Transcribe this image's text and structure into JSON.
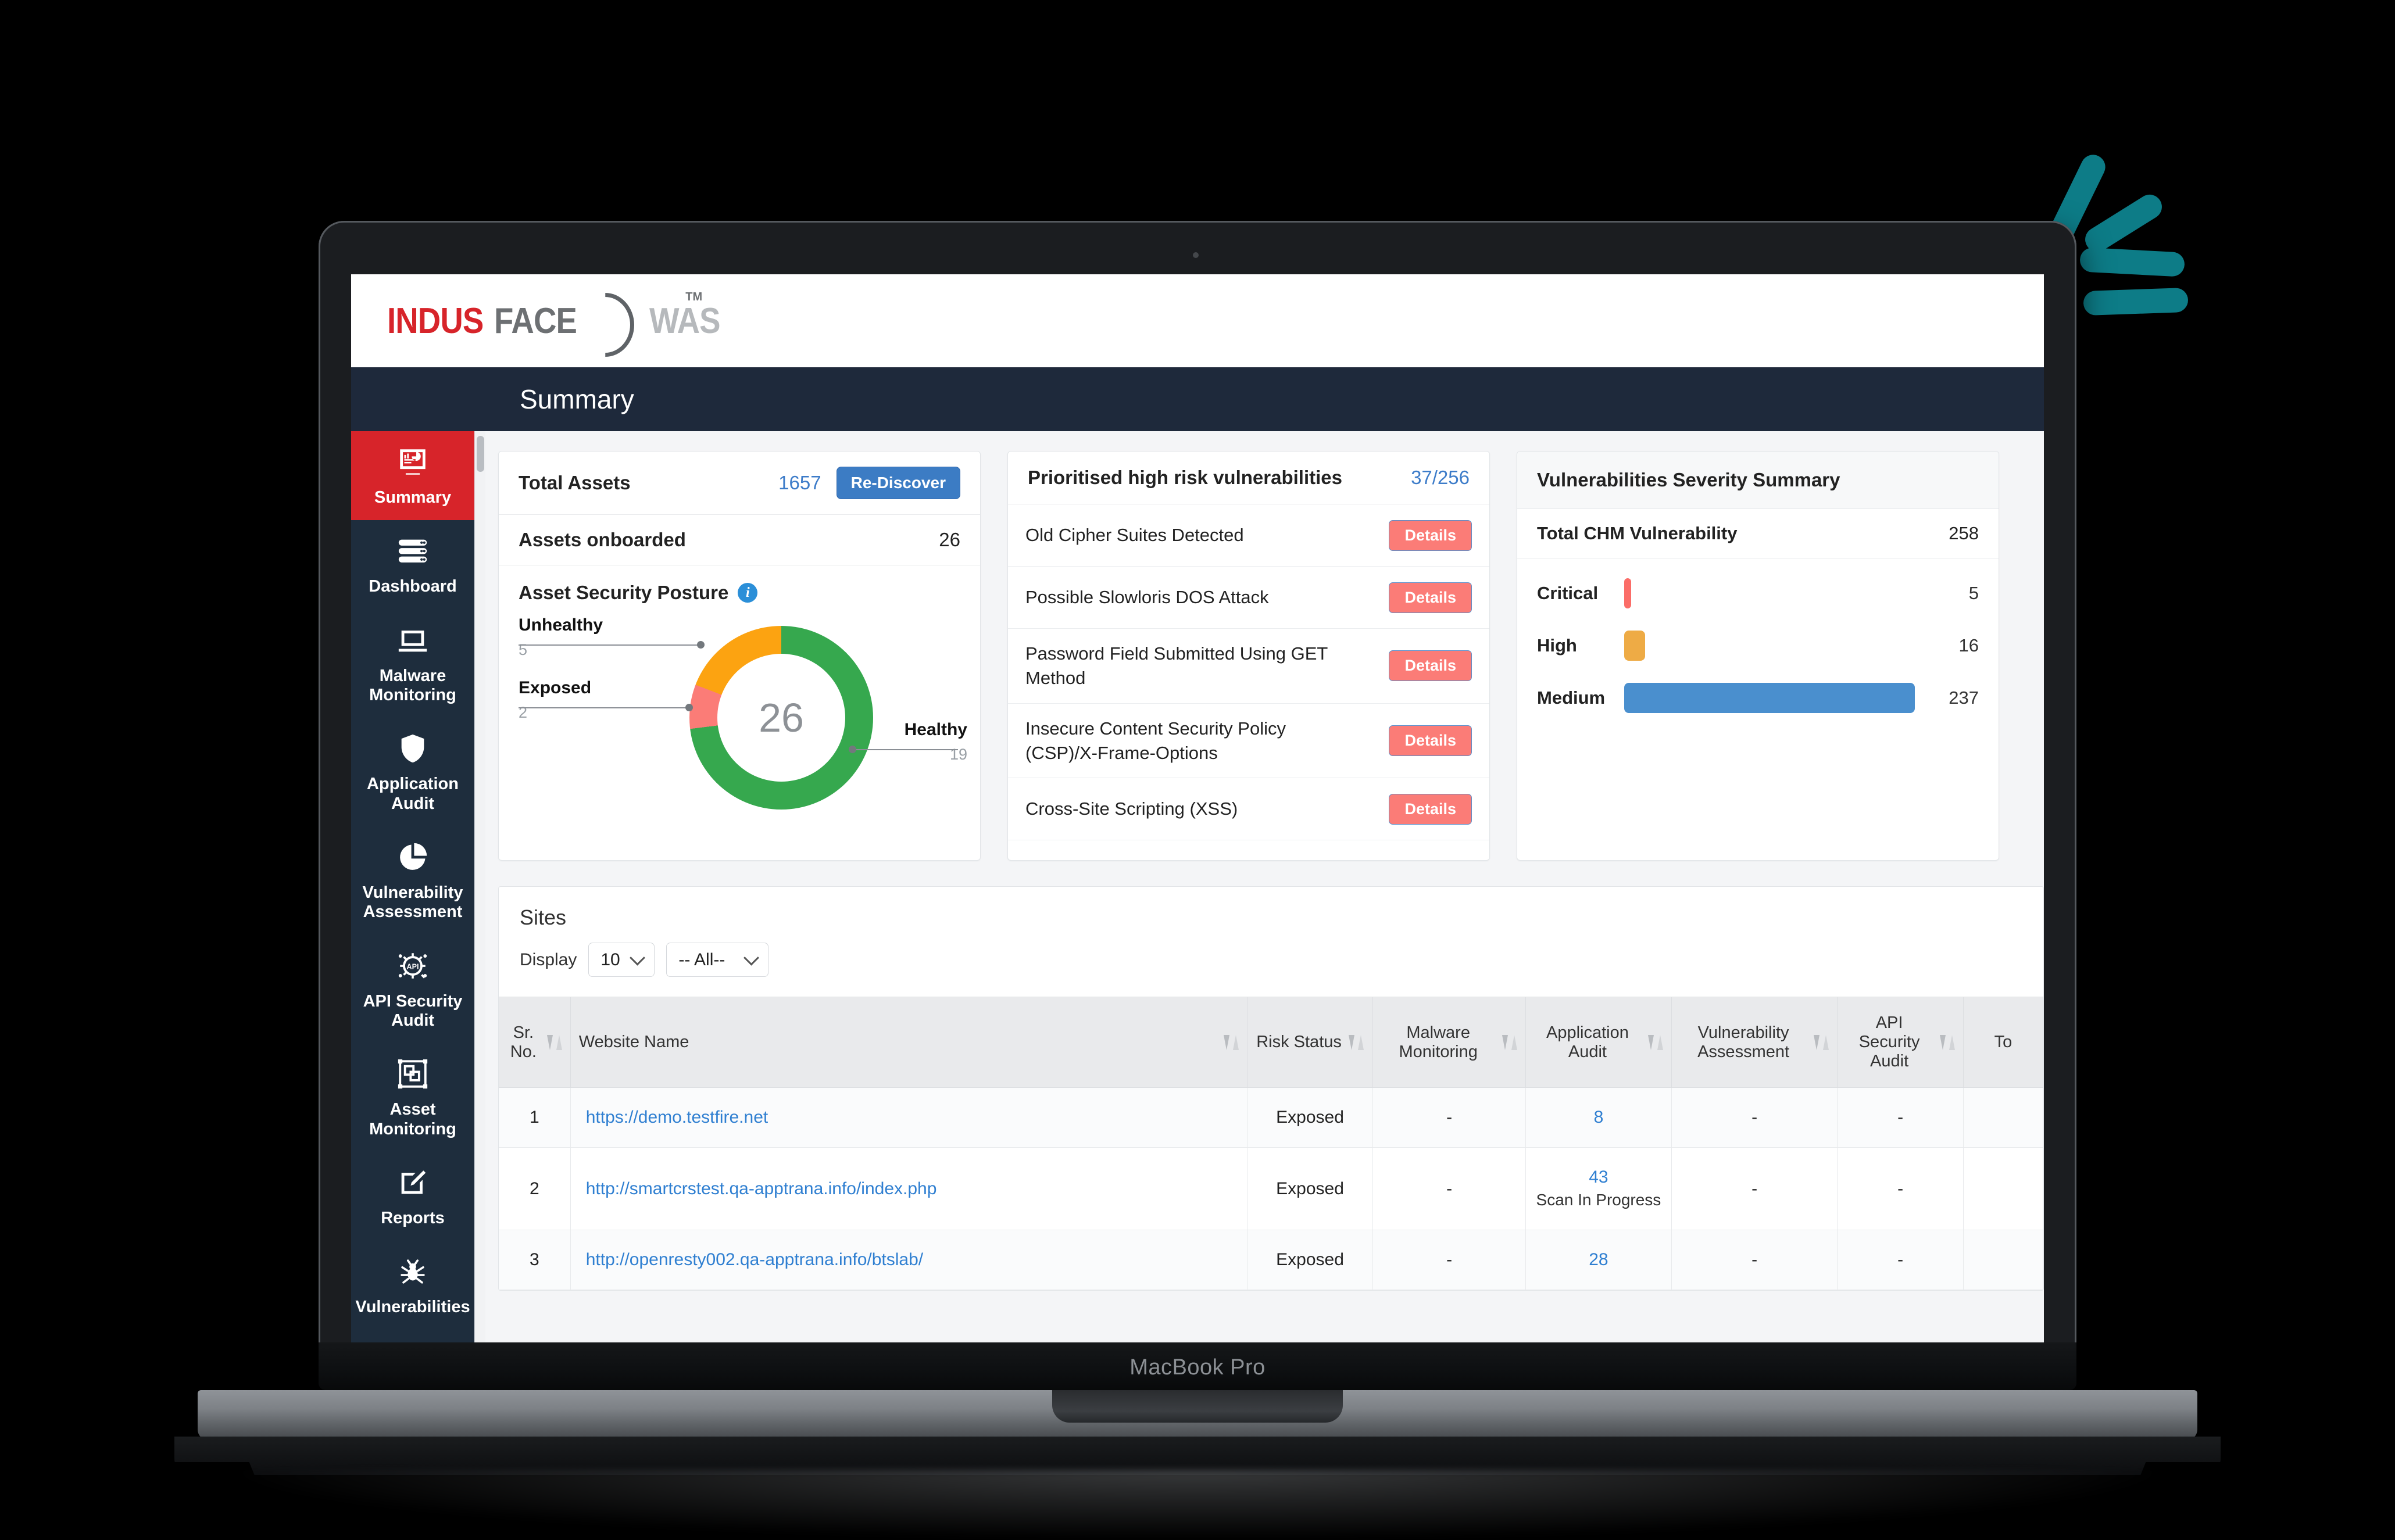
{
  "device": {
    "label": "MacBook Pro"
  },
  "brand": {
    "logo_part1": "INDUS",
    "logo_part2": "FACE",
    "logo_tm": "TM",
    "logo_product": "WAS",
    "accent_red": "#d7242a",
    "accent_teal": "#0d7c87",
    "navy": "#1e2d3d"
  },
  "topbar": {
    "title": "Summary"
  },
  "sidebar": {
    "items": [
      {
        "label": "Summary",
        "icon": "dashboard-report-icon",
        "active": true
      },
      {
        "label": "Dashboard",
        "icon": "server-stack-icon",
        "active": false
      },
      {
        "label": "Malware Monitoring",
        "icon": "laptop-icon",
        "active": false
      },
      {
        "label": "Application Audit",
        "icon": "shield-icon",
        "active": false
      },
      {
        "label": "Vulnerability Assessment",
        "icon": "pie-chart-icon",
        "active": false
      },
      {
        "label": "API Security Audit",
        "icon": "api-chip-icon",
        "active": false
      },
      {
        "label": "Asset Monitoring",
        "icon": "asset-frame-icon",
        "active": false
      },
      {
        "label": "Reports",
        "icon": "edit-document-icon",
        "active": false
      },
      {
        "label": "Vulnerabilities",
        "icon": "bug-spider-icon",
        "active": false
      }
    ]
  },
  "assets_card": {
    "total_label": "Total Assets",
    "total_value": "1657",
    "rediscover_label": "Re-Discover",
    "onboarded_label": "Assets onboarded",
    "onboarded_value": "26",
    "posture_title": "Asset Security Posture",
    "info_glyph": "i"
  },
  "vulns_card": {
    "title": "Prioritised high risk vulnerabilities",
    "count": "37/256",
    "details_label": "Details",
    "items": [
      {
        "name": "Old Cipher Suites Detected"
      },
      {
        "name": "Possible Slowloris DOS Attack"
      },
      {
        "name": "Password Field Submitted Using GET Method"
      },
      {
        "name": "Insecure Content Security Policy (CSP)/X-Frame-Options"
      },
      {
        "name": "Cross-Site Scripting (XSS)"
      }
    ]
  },
  "severity_card": {
    "title": "Vulnerabilities Severity Summary",
    "total_label": "Total CHM Vulnerability",
    "total_value": "258"
  },
  "sites": {
    "title": "Sites",
    "display_label": "Display",
    "page_size": "10",
    "filter": "-- All--",
    "columns": [
      "Sr. No.",
      "Website Name",
      "Risk Status",
      "Malware Monitoring",
      "Application Audit",
      "Vulnerability Assessment",
      "API Security Audit",
      "To"
    ],
    "rows": [
      {
        "sr": "1",
        "website": "https://demo.testfire.net",
        "risk": "Exposed",
        "malware": "-",
        "app_audit": "8",
        "app_audit_note": "",
        "vuln_assessment": "-",
        "api_audit": "-",
        "total": ""
      },
      {
        "sr": "2",
        "website": "http://smartcrstest.qa-apptrana.info/index.php",
        "risk": "Exposed",
        "malware": "-",
        "app_audit": "43",
        "app_audit_note": "Scan In Progress",
        "vuln_assessment": "-",
        "api_audit": "-",
        "total": ""
      },
      {
        "sr": "3",
        "website": "http://openresty002.qa-apptrana.info/btslab/",
        "risk": "Exposed",
        "malware": "-",
        "app_audit": "28",
        "app_audit_note": "",
        "vuln_assessment": "-",
        "api_audit": "-",
        "total": ""
      }
    ]
  },
  "chart_data": [
    {
      "type": "pie",
      "title": "Asset Security Posture",
      "center_label": "26",
      "labels": [
        "Healthy",
        "Unhealthy",
        "Exposed"
      ],
      "values": [
        19,
        5,
        2
      ],
      "colors": [
        "#36a84e",
        "#fca311",
        "#fb7c77"
      ],
      "legend": "callout-leaders",
      "total": 26
    },
    {
      "type": "bar",
      "title": "Vulnerabilities Severity Summary",
      "orientation": "horizontal",
      "categories": [
        "Critical",
        "High",
        "Medium"
      ],
      "values": [
        5,
        16,
        237
      ],
      "colors": [
        "#fb6d68",
        "#eeab45",
        "#4a8fce"
      ],
      "xlabel": "",
      "ylabel": "",
      "xlim": [
        0,
        237
      ],
      "grid": false,
      "total_label": "Total CHM Vulnerability",
      "total_value": 258
    }
  ]
}
